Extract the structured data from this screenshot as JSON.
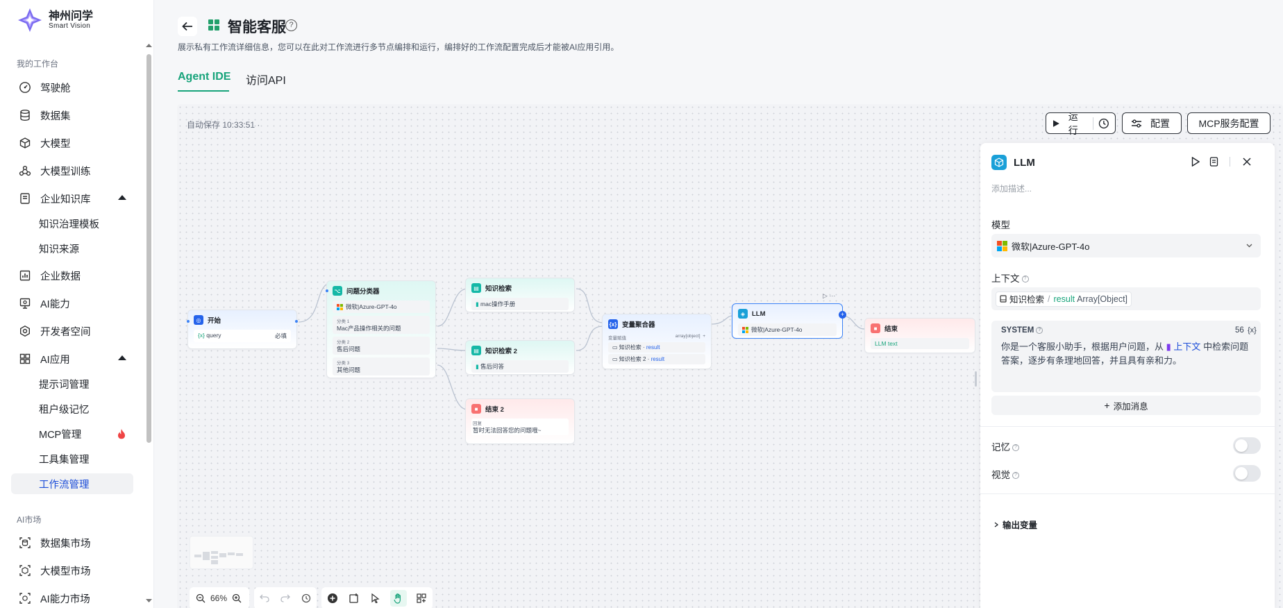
{
  "brand": {
    "name_cn": "神州问学",
    "name_en": "Smart Vision"
  },
  "sidebar": {
    "section_workspace": "我的工作台",
    "items": [
      {
        "label": "驾驶舱",
        "icon": "dashboard-icon"
      },
      {
        "label": "数据集",
        "icon": "database-icon"
      },
      {
        "label": "大模型",
        "icon": "cube-icon"
      },
      {
        "label": "大模型训练",
        "icon": "training-icon"
      },
      {
        "label": "企业知识库",
        "icon": "knowledge-icon"
      },
      {
        "label": "企业数据",
        "icon": "bar-chart-icon"
      },
      {
        "label": "AI能力",
        "icon": "ai-capability-icon"
      },
      {
        "label": "开发者空间",
        "icon": "developer-icon"
      },
      {
        "label": "AI应用",
        "icon": "grid-icon"
      }
    ],
    "knowledge_sub": [
      "知识治理模板",
      "知识来源"
    ],
    "ai_app_sub": [
      "提示词管理",
      "租户级记忆",
      "MCP管理",
      "工具集管理",
      "工作流管理"
    ],
    "section_market": "AI市场",
    "market_items": [
      {
        "label": "数据集市场",
        "icon": "dataset-market-icon"
      },
      {
        "label": "大模型市场",
        "icon": "model-market-icon"
      },
      {
        "label": "AI能力市场",
        "icon": "ai-market-icon"
      }
    ]
  },
  "header": {
    "title": "智能客服",
    "description": "展示私有工作流详细信息，您可以在此对工作流进行多节点编排和运行，编排好的工作流配置完成后才能被AI应用引用。",
    "tabs": [
      "Agent IDE",
      "访问API"
    ],
    "active_tab": "Agent IDE"
  },
  "canvas": {
    "autosave": "自动保存 10:33:51 ·",
    "toolbar": {
      "run": "运行",
      "config": "配置",
      "mcp": "MCP服务配置"
    },
    "zoom": "66%",
    "nodes": {
      "start": {
        "title": "开始",
        "var": "query",
        "required": "必填"
      },
      "classifier": {
        "title": "问题分类器",
        "model": "微软|Azure-GPT-4o",
        "classes": [
          {
            "label": "分类 1",
            "text": "Mac产品操作相关的问题"
          },
          {
            "label": "分类 2",
            "text": "售后问题"
          },
          {
            "label": "分类 3",
            "text": "其他问题"
          }
        ]
      },
      "kb1": {
        "title": "知识检索",
        "source": "mac操作手册"
      },
      "kb2": {
        "title": "知识检索 2",
        "source": "售后问答"
      },
      "end2": {
        "title": "结束 2",
        "reply_label": "回复",
        "reply": "暂时无法回答您的问题哦~"
      },
      "aggregator": {
        "title": "变量聚合器",
        "var_label": "变量赋值",
        "type": "array[object]",
        "rows": [
          {
            "node": "知识检索",
            "var": "result"
          },
          {
            "node": "知识检索 2",
            "var": "result"
          }
        ]
      },
      "llm": {
        "title": "LLM",
        "model": "微软|Azure-GPT-4o"
      },
      "end": {
        "title": "结束",
        "output": "LLM text"
      }
    }
  },
  "panel": {
    "title": "LLM",
    "desc_placeholder": "添加描述...",
    "model_label": "模型",
    "model_value": "微软|Azure-GPT-4o",
    "context_label": "上下文",
    "context_node": "知识检索",
    "context_sep": "/",
    "context_var": "result",
    "context_type": "Array[Object]",
    "system_label": "SYSTEM",
    "system_count": "56",
    "system_var_icon": "{x}",
    "system_prompt_a": "你是一个客服小助手，根据用户问题，从",
    "system_prompt_ref": "上下文",
    "system_prompt_b": "中检索问题答案，逐步有条理地回答，并且具有亲和力。",
    "add_message": "添加消息",
    "memory_label": "记忆",
    "vision_label": "视觉",
    "output_vars": "输出变量"
  },
  "colors": {
    "accent": "#16a37a",
    "link": "#1d4ed8",
    "brand_purple": "#6d5bd0"
  }
}
